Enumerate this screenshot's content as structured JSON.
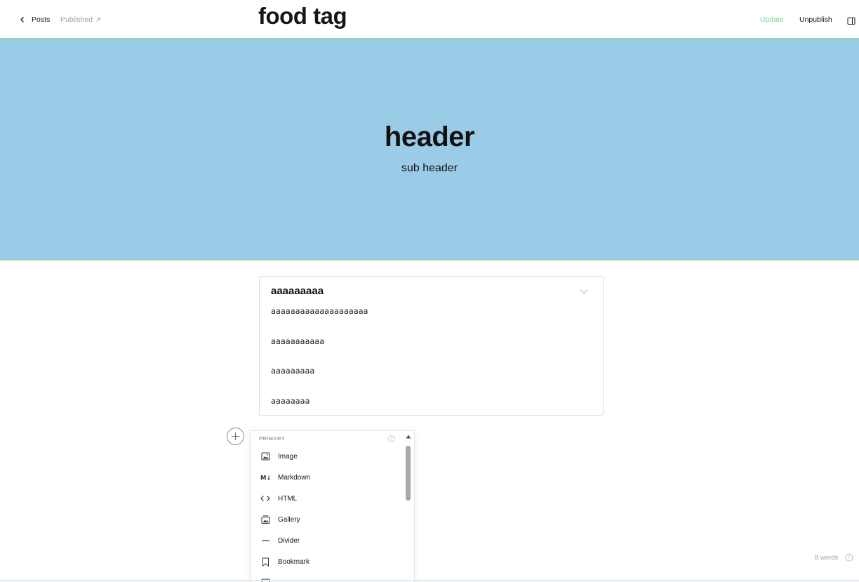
{
  "topbar": {
    "back_label": "Posts",
    "status_label": "Published",
    "update_label": "Update",
    "unpublish_label": "Unpublish",
    "accent_color": "#7cd68a"
  },
  "post": {
    "title": "food tag"
  },
  "header_card": {
    "title": "header",
    "subtitle": "sub header",
    "background_color": "#9acce8"
  },
  "toggle_card": {
    "heading": "aaaaaaaaa",
    "lines": [
      "aaaaaaaaaaaaaaaaaaaa",
      "aaaaaaaaaaa",
      "aaaaaaaaa",
      "aaaaaaaa"
    ]
  },
  "card_menu": {
    "section_label": "PRIMARY",
    "items": [
      {
        "label": "Image",
        "icon": "image-icon"
      },
      {
        "label": "Markdown",
        "icon": "markdown-icon"
      },
      {
        "label": "HTML",
        "icon": "code-icon"
      },
      {
        "label": "Gallery",
        "icon": "gallery-icon"
      },
      {
        "label": "Divider",
        "icon": "divider-icon"
      },
      {
        "label": "Bookmark",
        "icon": "bookmark-icon"
      }
    ]
  },
  "footer": {
    "word_count": "8 words"
  }
}
